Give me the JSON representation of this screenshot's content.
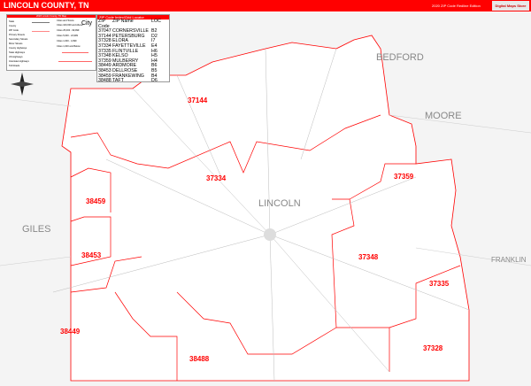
{
  "header": {
    "title": "LINCOLN COUNTY, TN",
    "edition": "2020 ZIP Code Redline Edition",
    "logo": "Digital Maps Store"
  },
  "legend": {
    "title": "2020 Lincoln County, TN Map",
    "items": [
      "State",
      "County",
      "ZIP Code",
      "Primary Streets",
      "Secondary Streets",
      "Minor Streets",
      "County Highways",
      "State Highways",
      "US Highways",
      "Interstate Highways",
      "Toll Roads"
    ],
    "cities_title": "Cities and Towns",
    "cities": [
      "Cities 100,000 and Above",
      "Cities 25,000 - 99,999",
      "Cities 5,000 - 24,999",
      "Cities 1,000 - 4,999",
      "Cities 1,000 and Below"
    ],
    "city_sample": "City"
  },
  "zip_table": {
    "title": "ZIP Code Index/Grid Locator",
    "columns": [
      "ZIP Code",
      "ZIP Name",
      "LOC"
    ],
    "rows": [
      [
        "37047",
        "CORNERSVILLE",
        "B2"
      ],
      [
        "37144",
        "PETERSBURG",
        "D2"
      ],
      [
        "37328",
        "ELORA",
        "I7"
      ],
      [
        "37334",
        "FAYETTEVILLE",
        "E4"
      ],
      [
        "37335",
        "FLINTVILLE",
        "H6"
      ],
      [
        "37348",
        "KELSO",
        "H5"
      ],
      [
        "37359",
        "MULBERRY",
        "H4"
      ],
      [
        "38449",
        "ARDMORE",
        "B6"
      ],
      [
        "38453",
        "DELLROSE",
        "B5"
      ],
      [
        "38459",
        "FRANKEWING",
        "B4"
      ],
      [
        "38488",
        "TAFT",
        "D6"
      ]
    ]
  },
  "counties": [
    "LINCOLN",
    "BEDFORD",
    "MOORE",
    "GILES",
    "FRANKLIN"
  ],
  "zip_labels": [
    "37144",
    "37334",
    "37359",
    "38459",
    "38453",
    "37348",
    "37335",
    "38449",
    "38488",
    "37328"
  ],
  "colors": {
    "accent": "#ff0000",
    "county_label": "#888888"
  }
}
